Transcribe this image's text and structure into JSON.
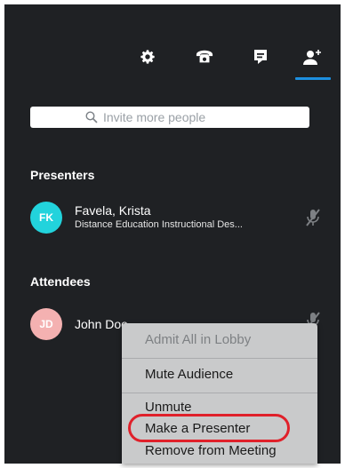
{
  "toolbar": {
    "icons": [
      "gear-icon",
      "phone-icon",
      "chat-icon",
      "add-person-icon"
    ],
    "active_tab": "add-person-icon",
    "accent_color": "#1d8fe0"
  },
  "search": {
    "placeholder": "Invite more people"
  },
  "presenters": {
    "title": "Presenters",
    "people": [
      {
        "initials": "FK",
        "name": "Favela, Krista",
        "subtitle": "Distance Education Instructional Des...",
        "avatar_color": "#22d3dc"
      }
    ]
  },
  "attendees": {
    "title": "Attendees",
    "people": [
      {
        "initials": "JD",
        "name": "John Doe",
        "avatar_color": "#f4b1b1"
      }
    ]
  },
  "context_menu": {
    "items": [
      {
        "label": "Admit All in Lobby",
        "enabled": false
      },
      {
        "label": "Mute Audience",
        "enabled": true
      },
      {
        "label": "Unmute",
        "enabled": true
      },
      {
        "label": "Make a Presenter",
        "enabled": true,
        "highlighted": true
      },
      {
        "label": "Remove from Meeting",
        "enabled": true
      }
    ],
    "highlight_color": "#e0202a"
  }
}
